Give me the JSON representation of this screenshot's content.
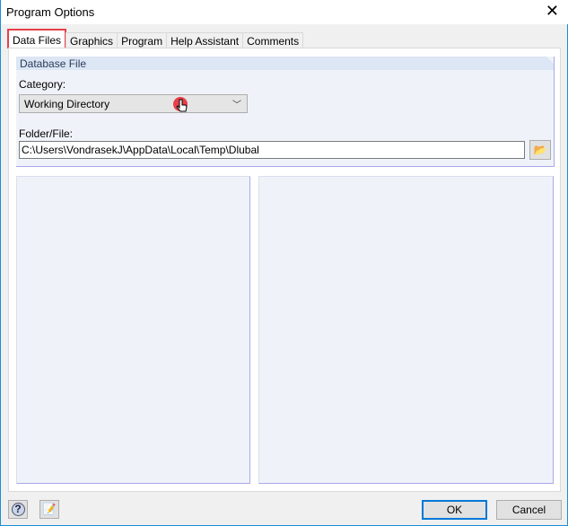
{
  "window": {
    "title": "Program Options"
  },
  "tabs": [
    {
      "label": "Data Files",
      "active": true
    },
    {
      "label": "Graphics"
    },
    {
      "label": "Program"
    },
    {
      "label": "Help Assistant"
    },
    {
      "label": "Comments"
    }
  ],
  "database_file": {
    "header": "Database File",
    "category_label": "Category:",
    "category_value": "Working Directory",
    "folder_label": "Folder/File:",
    "folder_value": "C:\\Users\\VondrasekJ\\AppData\\Local\\Temp\\Dlubal"
  },
  "footer": {
    "ok_label": "OK",
    "cancel_label": "Cancel"
  },
  "colors": {
    "highlight": "#e8404a",
    "accent": "#1c8fd6"
  }
}
